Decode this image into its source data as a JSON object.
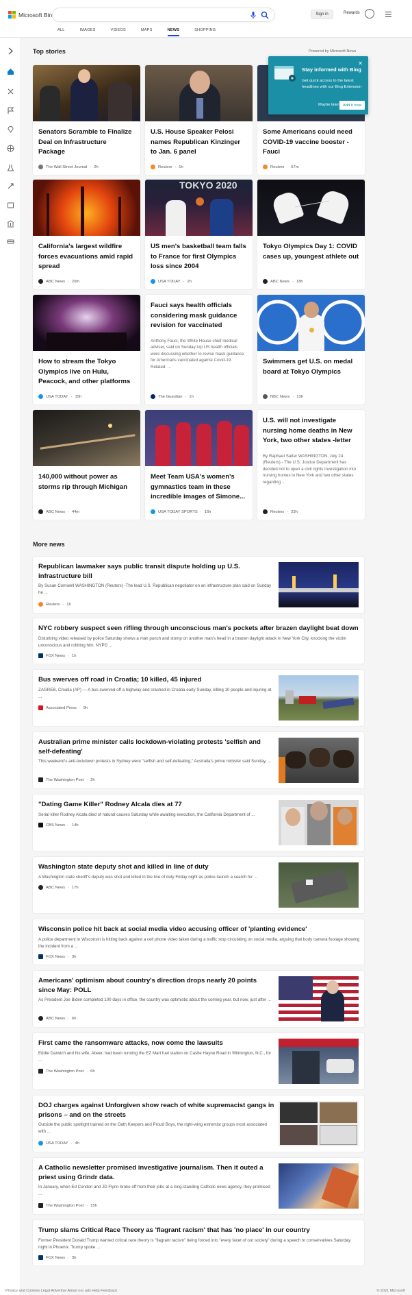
{
  "header": {
    "logo_text": "Microsoft Bing",
    "signin": "Sign in",
    "rewards": "Rewards",
    "nav": [
      "ALL",
      "IMAGES",
      "VIDEOS",
      "MAPS",
      "NEWS",
      "SHOPPING"
    ],
    "active_nav": "NEWS"
  },
  "top_stories": {
    "title": "Top stories",
    "powered": "Powered by Microsoft News"
  },
  "popup": {
    "title": "Stay informed with Bing",
    "body": "Get quick access to the latest headlines with our Bing Extension",
    "maybe_later": "Maybe later",
    "add_now": "Add it now"
  },
  "cards": [
    {
      "title": "Senators Scramble to Finalize Deal on Infrastructure Package",
      "source": "The Wall Street Journal",
      "time": "2h",
      "color": "#777"
    },
    {
      "title": "U.S. House Speaker Pelosi names Republican Kinzinger to Jan. 6 panel",
      "source": "Reuters",
      "time": "1h",
      "color": "#f38a29"
    },
    {
      "title": "Some Americans could need COVID-19 vaccine booster - Fauci",
      "source": "Reuters",
      "time": "57m",
      "color": "#f38a29"
    },
    {
      "title": "California's largest wildfire forces evacuations amid rapid spread",
      "source": "ABC News",
      "time": "20m",
      "color": "#222"
    },
    {
      "title": "US men's basketball team falls to France for first Olympics loss since 2004",
      "source": "USA TODAY",
      "time": "2h",
      "color": "#1a94e8"
    },
    {
      "title": "Tokyo Olympics Day 1: COVID cases up, youngest athlete out",
      "source": "ABC News",
      "time": "18h",
      "color": "#222"
    },
    {
      "title": "How to stream the Tokyo Olympics live on Hulu, Peacock, and other platforms",
      "source": "USA TODAY",
      "time": "15h",
      "color": "#1a94e8"
    },
    {
      "title": "Fauci says health officials considering mask guidance revision for vaccinated",
      "snippet": "Anthony Fauci, the White House chief medical adviser, said on Sunday top US health officials were discussing whether to revise mask guidance for Americans vaccinated against Covid-19. Related: ...",
      "source": "The Guardian",
      "time": "1h",
      "color": "#052962"
    },
    {
      "title": "Swimmers get U.S. on medal board at Tokyo Olympics",
      "source": "NBC News",
      "time": "13h",
      "color": "#555"
    },
    {
      "title": "140,000 without power as storms rip through Michigan",
      "source": "ABC News",
      "time": "44m",
      "color": "#222"
    },
    {
      "title": "Meet Team USA's women's gymnastics team in these incredible images of Simone...",
      "source": "USA TODAY SPORTS",
      "time": "16h",
      "color": "#1a94e8"
    },
    {
      "title": "U.S. will not investigate nursing home deaths in New York, two other states -letter",
      "snippet": "By Raphael Satter WASHINGTON, July 24 (Reuters) - The U.S. Justice Department has decided not to open a civil rights investigation into nursing homes in New York and two other states regarding ...",
      "source": "Reuters",
      "time": "23h",
      "color": "#222"
    }
  ],
  "more_news": {
    "title": "More news",
    "items": [
      {
        "title": "Republican lawmaker says public transit dispute holding up U.S. infrastructure bill",
        "snippet": "By Susan Cornwell WASHINGTON (Reuters) -The lead U.S. Republican negotiator on an infrastructure plan said on Sunday he ...",
        "source": "Reuters",
        "time": "1h",
        "color": "#f38a29"
      },
      {
        "title": "NYC robbery suspect seen rifling through unconscious man's pockets after brazen daylight beat down",
        "snippet": "Disturbing video released by police Saturday shows a man punch and stomp on another man's head in a brazen daylight attack in New York City, knocking the victim unconscious and robbing him. NYPD ...",
        "source": "FOX News",
        "time": "1h",
        "color": "#003366"
      },
      {
        "title": "Bus swerves off road in Croatia; 10 killed, 45 injured",
        "snippet": "ZAGREB, Croatia (AP) — A bus swerved off a highway and crashed in Croatia early Sunday, killing 10 people and injuring at ...",
        "source": "Associated Press",
        "time": "9h",
        "color": "#e0101a"
      },
      {
        "title": "Australian prime minister calls lockdown-violating protests 'selfish and self-defeating'",
        "snippet": "This weekend's anti-lockdown protests in Sydney were \"selfish and self-defeating,\" Australia's prime minister said Sunday, ...",
        "source": "The Washington Post",
        "time": "2h",
        "color": "#222"
      },
      {
        "title": "\"Dating Game Killer\" Rodney Alcala dies at 77",
        "snippet": "Serial killer Rodney Alcala died of natural causes Saturday while awaiting execution, the California Department of ...",
        "source": "CBS News",
        "time": "14h",
        "color": "#111"
      },
      {
        "title": "Washington state deputy shot and killed in line of duty",
        "snippet": "A Washington state sheriff's deputy was shot and killed in the line of duty Friday night as police launch a search for ...",
        "source": "ABC News",
        "time": "17h",
        "color": "#222"
      },
      {
        "title": "Wisconsin police hit back at social media video accusing officer of 'planting evidence'",
        "snippet": "A police department in Wisconsin is hitting back against a cell phone video taken during a traffic stop circulating on social media, arguing that body camera footage showing the incident from a ...",
        "source": "FOX News",
        "time": "3h",
        "color": "#003366"
      },
      {
        "title": "Americans' optimism about country's direction drops nearly 20 points since May: POLL",
        "snippet": "As President Joe Biden completed 100 days in office, the country was optimistic about the coming year, but now, just after ...",
        "source": "ABC News",
        "time": "6h",
        "color": "#222"
      },
      {
        "title": "First came the ransomware attacks, now come the lawsuits",
        "snippet": "Eddie Darwich and his wife, Abeer, had been running the EZ Mart fuel station on Castle Hayne Road in Wilmington, N.C., for ...",
        "source": "The Washington Post",
        "time": "6h",
        "color": "#222"
      },
      {
        "title": "DOJ charges against Unforgiven show reach of white supremacist gangs in prisons – and on the streets",
        "snippet": "Outside the public spotlight trained on the Oath Keepers and Proud Boys, the right-wing extremist groups most associated with ...",
        "source": "USA TODAY",
        "time": "4h",
        "color": "#1a94e8"
      },
      {
        "title": "A Catholic newsletter promised investigative journalism. Then it outed a priest using Grindr data.",
        "snippet": "In January, when Ed Condon and JD Flynn broke off from their jobs at a long-standing Catholic news agency, they promised ...",
        "source": "The Washington Post",
        "time": "15h",
        "color": "#222"
      },
      {
        "title": "Trump slams Critical Race Theory as 'flagrant racism' that has 'no place' in our country",
        "snippet": "Former President Donald Trump warned critical race theory is \"flagrant racism\" being forced into \"every facet of our society\" during a speech to conservatives Saturday night in Phoenix. Trump spoke ...",
        "source": "FOX News",
        "time": "3h",
        "color": "#003366"
      }
    ]
  },
  "footer": {
    "left": "Privacy and Cookies   Legal   Advertise   About our ads   Help   Feedback",
    "right": "© 2021 Microsoft"
  }
}
